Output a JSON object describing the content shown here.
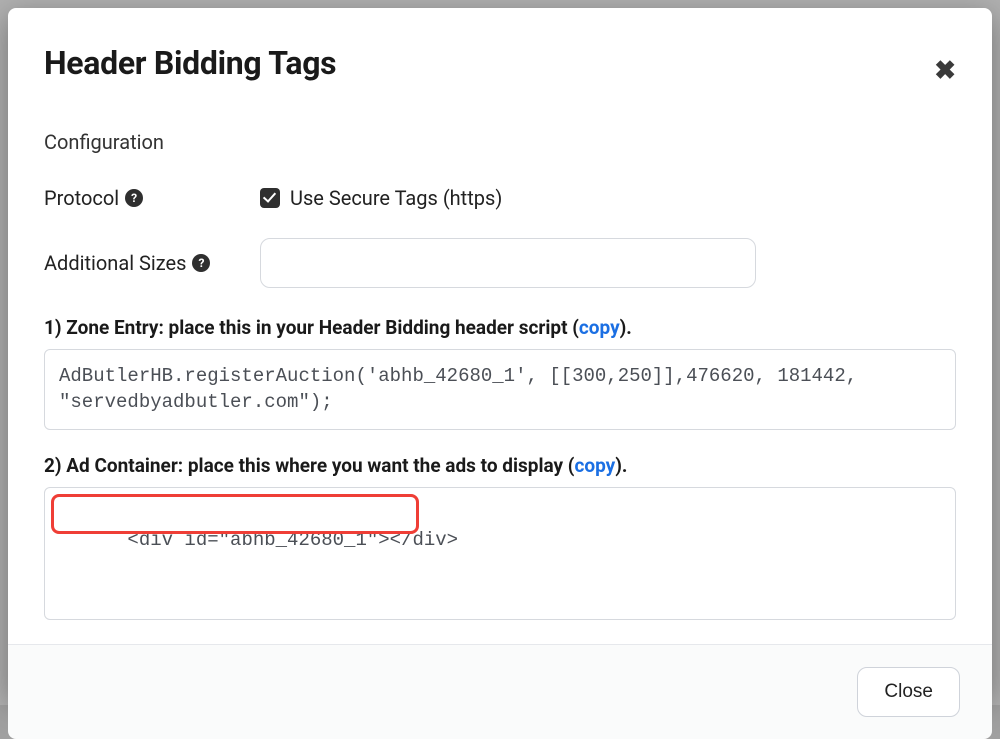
{
  "modal": {
    "title": "Header Bidding Tags",
    "close_icon": "✖",
    "config_label": "Configuration",
    "protocol_label": "Protocol",
    "secure_tags_label": "Use Secure Tags (https)",
    "secure_tags_checked": true,
    "additional_sizes_label": "Additional Sizes",
    "additional_sizes_value": "",
    "step1_prefix": "1) Zone Entry: place this in your Header Bidding header script (",
    "step1_copy": "copy",
    "step1_suffix": ").",
    "step1_code": "AdButlerHB.registerAuction('abhb_42680_1', [[300,250]],476620, 181442, \"servedbyadbutler.com\");",
    "step2_prefix": "2) Ad Container: place this where you want the ads to display (",
    "step2_copy": "copy",
    "step2_suffix": ").",
    "step2_code": "<div id=\"abhb_42680_1\"></div>",
    "close_button": "Close",
    "help_glyph": "?"
  }
}
